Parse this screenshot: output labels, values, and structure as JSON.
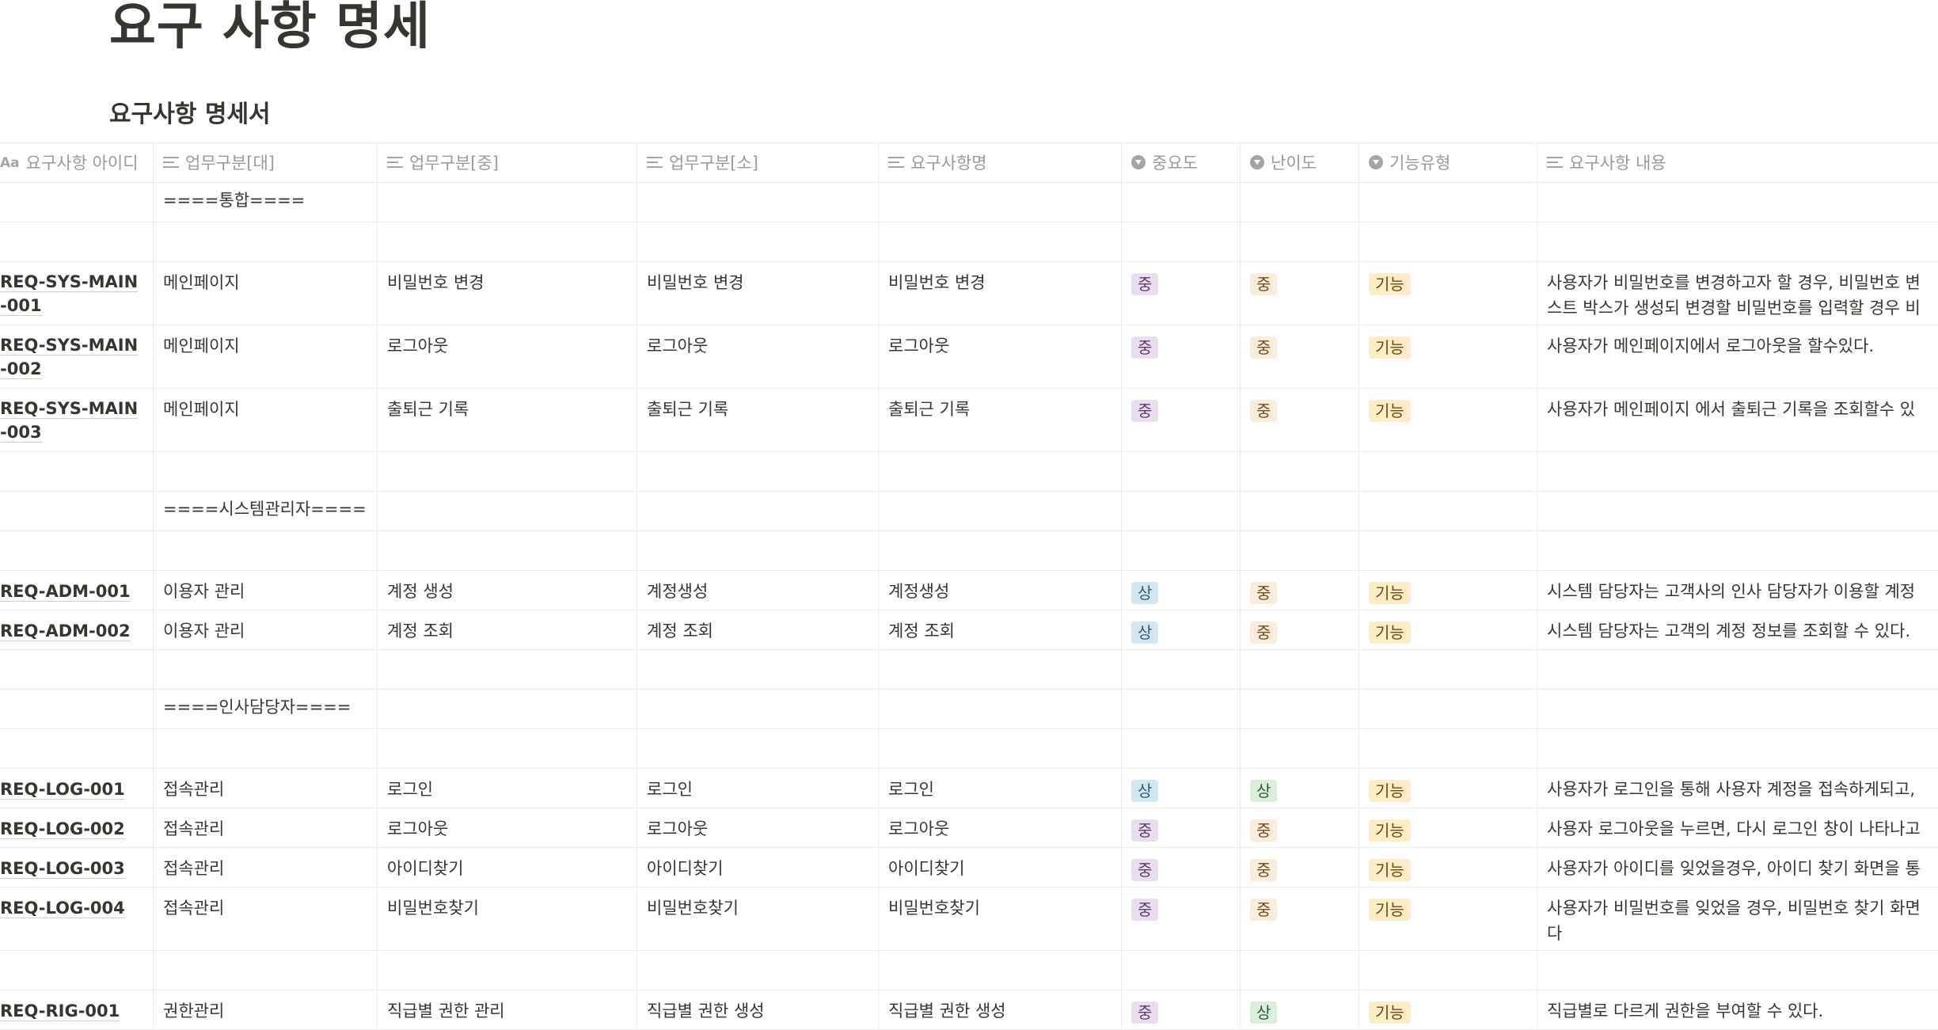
{
  "page": {
    "title": "요구 사항 명세",
    "database_title": "요구사항 명세서"
  },
  "columns": [
    {
      "label": "요구사항 아이디",
      "icon": "title-aa-icon"
    },
    {
      "label": "업무구분[대]",
      "icon": "text-lines-icon"
    },
    {
      "label": "업무구분[중]",
      "icon": "text-lines-icon"
    },
    {
      "label": "업무구분[소]",
      "icon": "text-lines-icon"
    },
    {
      "label": "요구사항명",
      "icon": "text-lines-icon"
    },
    {
      "label": "중요도",
      "icon": "select-icon"
    },
    {
      "label": "난이도",
      "icon": "select-icon"
    },
    {
      "label": "기능유형",
      "icon": "select-icon"
    },
    {
      "label": "요구사항 내용",
      "icon": "text-lines-icon"
    }
  ],
  "rows": [
    {
      "id": "",
      "major": "====통합====",
      "mid": "",
      "minor": "",
      "name": "",
      "importance": "",
      "difficulty": "",
      "type": "",
      "content": ""
    },
    {
      "id": "",
      "major": "",
      "mid": "",
      "minor": "",
      "name": "",
      "importance": "",
      "difficulty": "",
      "type": "",
      "content": ""
    },
    {
      "id": "REQ-SYS-MAIN-001",
      "major": "메인페이지",
      "mid": "비밀번호 변경",
      "minor": "비밀번호 변경",
      "name": "비밀번호 변경",
      "importance": "중",
      "difficulty": "중",
      "type": "기능",
      "content": "사용자가 비밀번호를 변경하고자 할 경우, 비밀번호 변",
      "content2": "스트 박스가 생성되 변경할 비밀번호를 입력할 경우 비"
    },
    {
      "id": "REQ-SYS-MAIN-002",
      "major": "메인페이지",
      "mid": "로그아웃",
      "minor": "로그아웃",
      "name": "로그아웃",
      "importance": "중",
      "difficulty": "중",
      "type": "기능",
      "content": "사용자가 메인페이지에서 로그아웃을 할수있다."
    },
    {
      "id": "REQ-SYS-MAIN-003",
      "major": "메인페이지",
      "mid": "출퇴근 기록",
      "minor": "출퇴근 기록",
      "name": "출퇴근 기록",
      "importance": "중",
      "difficulty": "중",
      "type": "기능",
      "content": "사용자가 메인페이지 에서 출퇴근 기록을 조회할수 있"
    },
    {
      "id": "",
      "major": "",
      "mid": "",
      "minor": "",
      "name": "",
      "importance": "",
      "difficulty": "",
      "type": "",
      "content": ""
    },
    {
      "id": "",
      "major": "====시스템관리자====",
      "mid": "",
      "minor": "",
      "name": "",
      "importance": "",
      "difficulty": "",
      "type": "",
      "content": ""
    },
    {
      "id": "",
      "major": "",
      "mid": "",
      "minor": "",
      "name": "",
      "importance": "",
      "difficulty": "",
      "type": "",
      "content": ""
    },
    {
      "id": "REQ-ADM-001",
      "major": "이용자 관리",
      "mid": "계정 생성",
      "minor": "계정생성",
      "name": "계정생성",
      "importance": "상",
      "difficulty": "중",
      "type": "기능",
      "content": "시스템 담당자는 고객사의 인사 담당자가 이용할 계정"
    },
    {
      "id": "REQ-ADM-002",
      "major": "이용자 관리",
      "mid": "계정 조회",
      "minor": "계정 조회",
      "name": "계정 조회",
      "importance": "상",
      "difficulty": "중",
      "type": "기능",
      "content": "시스템 담당자는 고객의 계정 정보를 조회할 수 있다."
    },
    {
      "id": "",
      "major": "",
      "mid": "",
      "minor": "",
      "name": "",
      "importance": "",
      "difficulty": "",
      "type": "",
      "content": ""
    },
    {
      "id": "",
      "major": "====인사담당자====",
      "mid": "",
      "minor": "",
      "name": "",
      "importance": "",
      "difficulty": "",
      "type": "",
      "content": ""
    },
    {
      "id": "",
      "major": "",
      "mid": "",
      "minor": "",
      "name": "",
      "importance": "",
      "difficulty": "",
      "type": "",
      "content": ""
    },
    {
      "id": "REQ-LOG-001",
      "major": "접속관리",
      "mid": "로그인",
      "minor": "로그인",
      "name": "로그인",
      "importance": "상",
      "difficulty": "상",
      "type": "기능",
      "content": "사용자가 로그인을 통해 사용자 계정을 접속하게되고,"
    },
    {
      "id": "REQ-LOG-002",
      "major": "접속관리",
      "mid": "로그아웃",
      "minor": "로그아웃",
      "name": "로그아웃",
      "importance": "중",
      "difficulty": "중",
      "type": "기능",
      "content": "사용자 로그아웃을 누르면, 다시 로그인 창이 나타나고"
    },
    {
      "id": "REQ-LOG-003",
      "major": "접속관리",
      "mid": "아이디찾기",
      "minor": "아이디찾기",
      "name": "아이디찾기",
      "importance": "중",
      "difficulty": "중",
      "type": "기능",
      "content": "사용자가 아이디를 잊었을경우, 아이디 찾기 화면을 통"
    },
    {
      "id": "REQ-LOG-004",
      "major": "접속관리",
      "mid": "비밀번호찾기",
      "minor": "비밀번호찾기",
      "name": "비밀번호찾기",
      "importance": "중",
      "difficulty": "중",
      "type": "기능",
      "content": "사용자가 비밀번호를 잊었을 경우, 비밀번호 찾기 화면",
      "content2": "다"
    },
    {
      "id": "",
      "major": "",
      "mid": "",
      "minor": "",
      "name": "",
      "importance": "",
      "difficulty": "",
      "type": "",
      "content": ""
    },
    {
      "id": "REQ-RIG-001",
      "major": "권한관리",
      "mid": "직급별 권한 관리",
      "minor": "직급별 권한 생성",
      "name": "직급별 권한 생성",
      "importance": "중",
      "difficulty": "상",
      "type": "기능",
      "content": "직급별로 다르게 권한을 부여할 수 있다."
    }
  ],
  "tag_colors": {
    "중요도": {
      "상": "#d3e5ef",
      "중": "#e8deee"
    },
    "난이도": {
      "상": "#dbeddb",
      "중": "#fbecdd"
    },
    "기능유형": {
      "기능": "#fdecc8"
    }
  }
}
